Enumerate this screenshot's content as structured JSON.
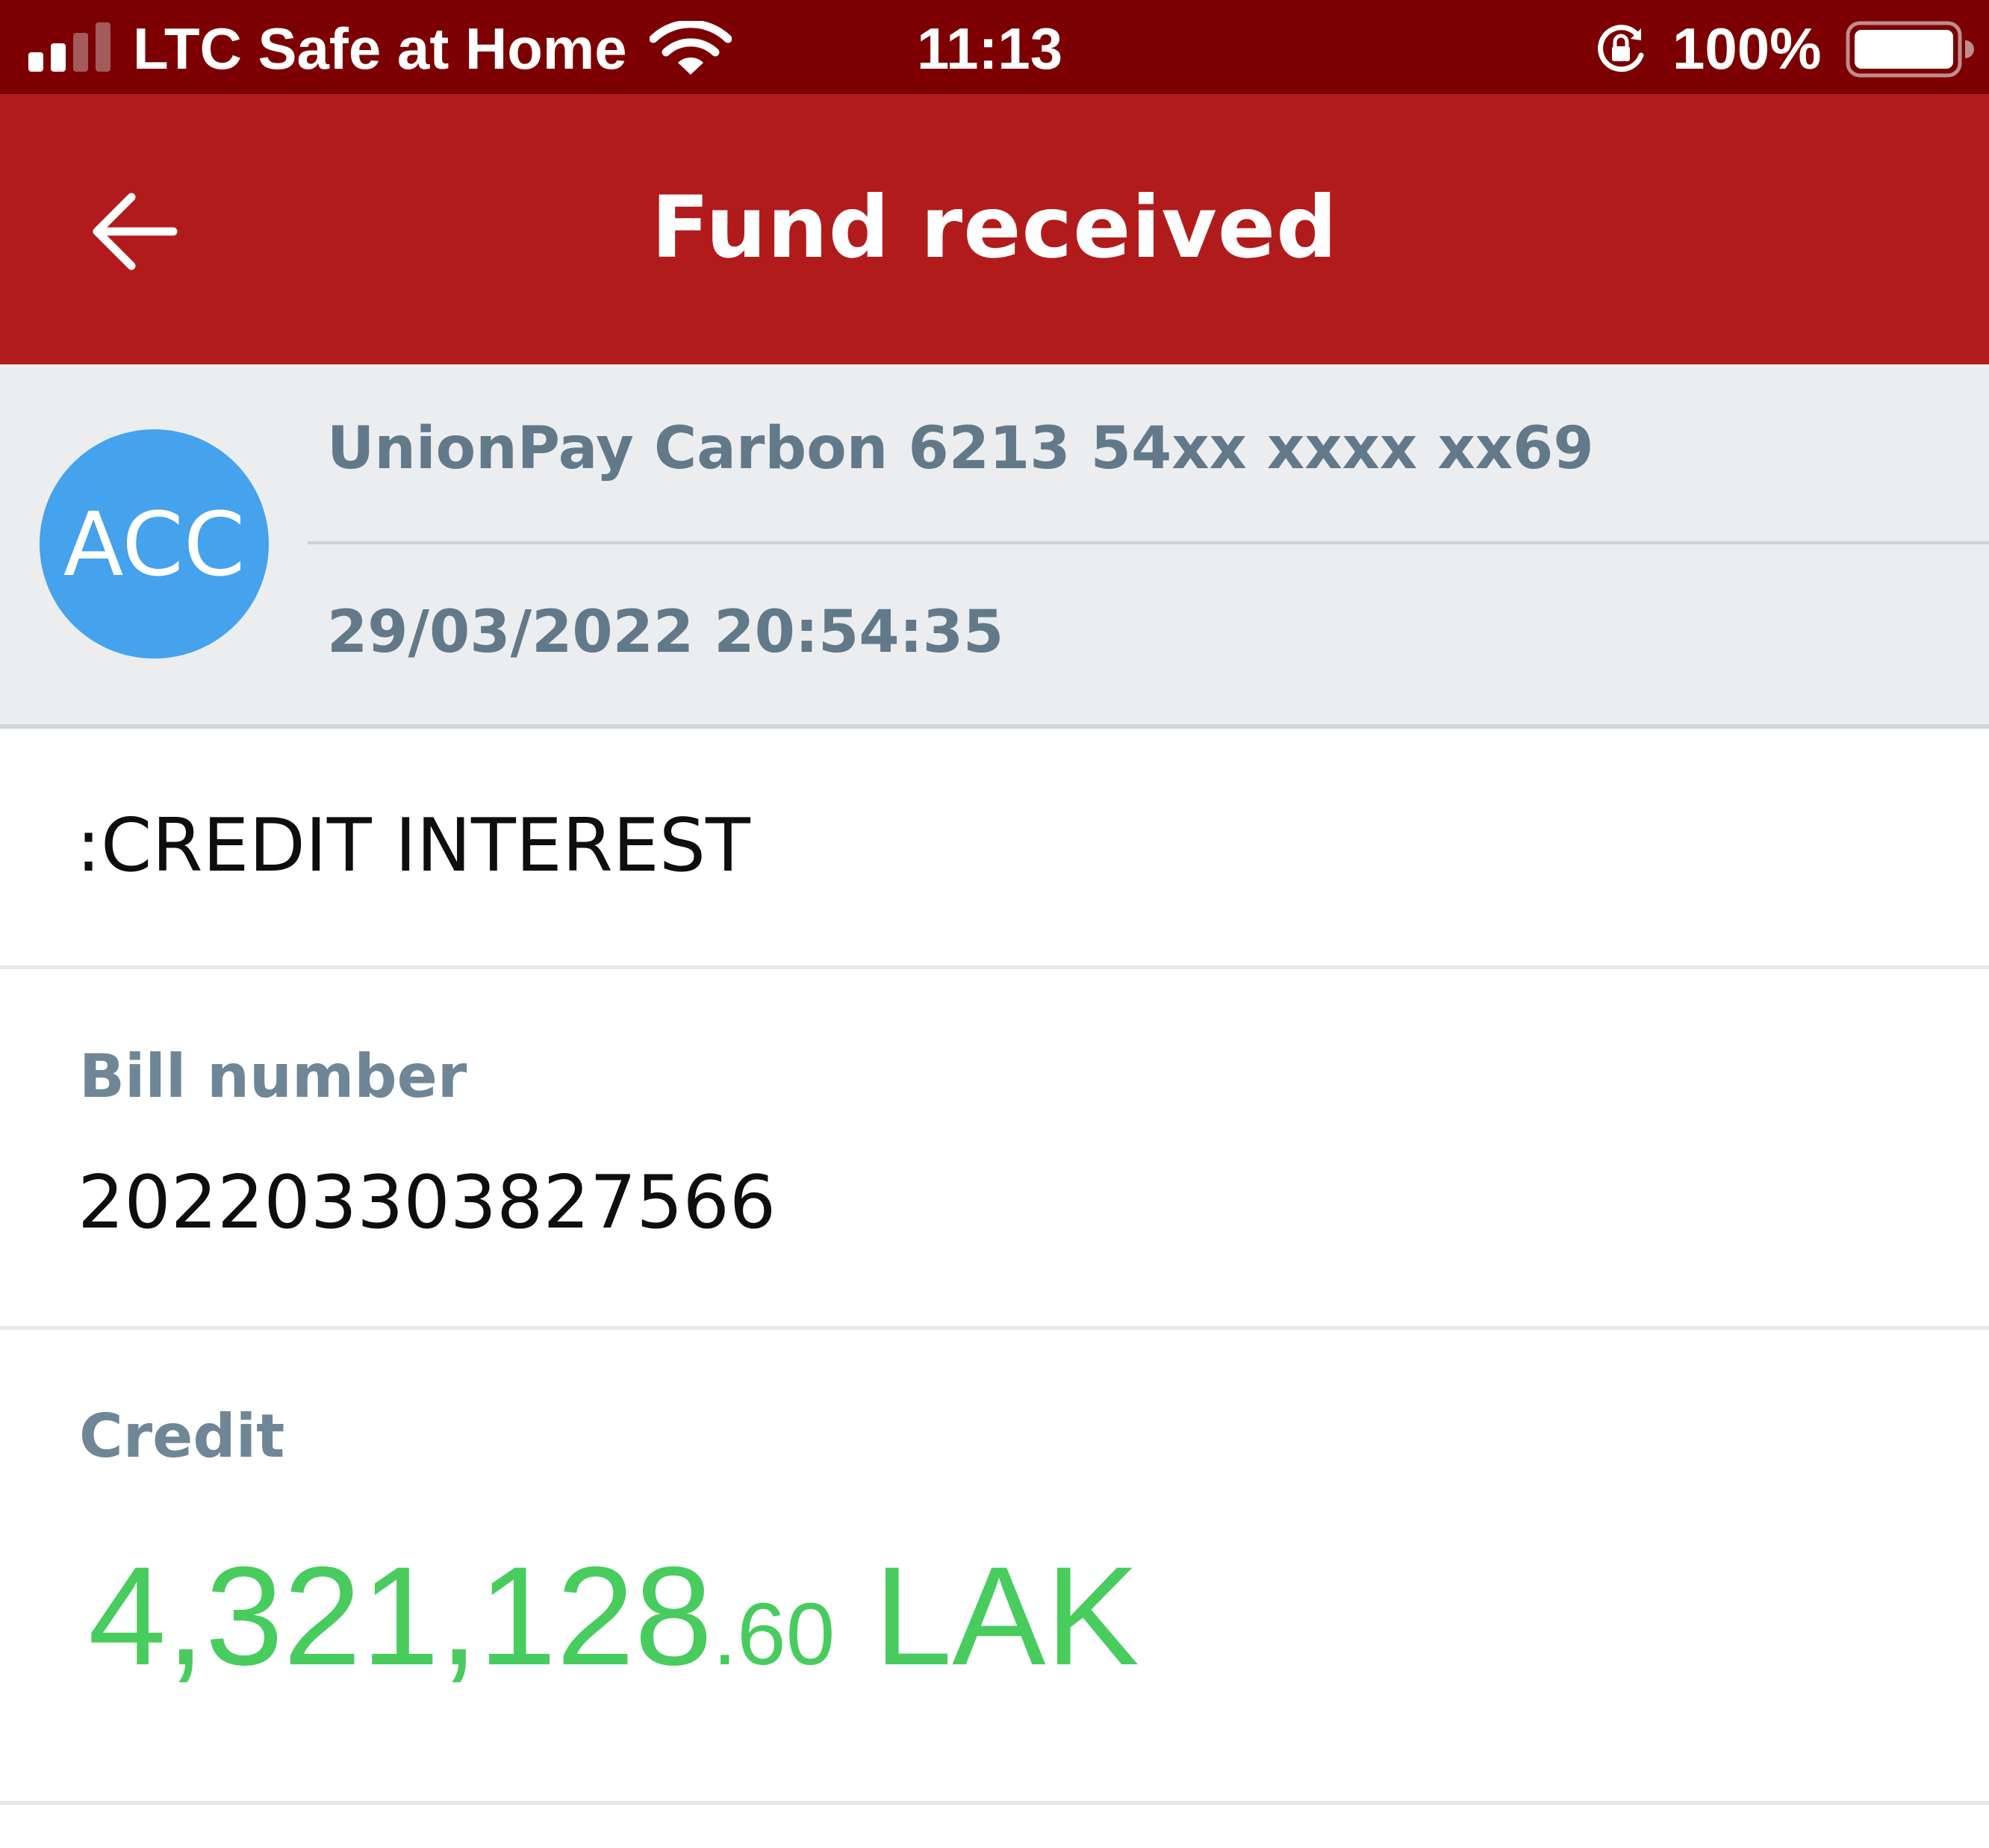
{
  "status_bar": {
    "carrier": "LTC Safe at Home",
    "time": "11:13",
    "battery_percent": "100%"
  },
  "header": {
    "title": "Fund received",
    "back_icon": "arrow-left-icon"
  },
  "account": {
    "avatar_text": "ACC",
    "avatar_color": "#45a2ec",
    "name": "UnionPay Carbon 6213 54xx xxxx xx69",
    "datetime": "29/03/2022 20:54:35"
  },
  "details": {
    "description": ":CREDIT INTEREST",
    "bill_label": "Bill number",
    "bill_value": "202203303827566",
    "credit_label": "Credit",
    "credit_integer": "4,321,128",
    "credit_decimal": ".60",
    "credit_currency": " LAK"
  },
  "colors": {
    "status_bar": "#7c0002",
    "header": "#b21b1c",
    "credit_green": "#48cc5e"
  }
}
